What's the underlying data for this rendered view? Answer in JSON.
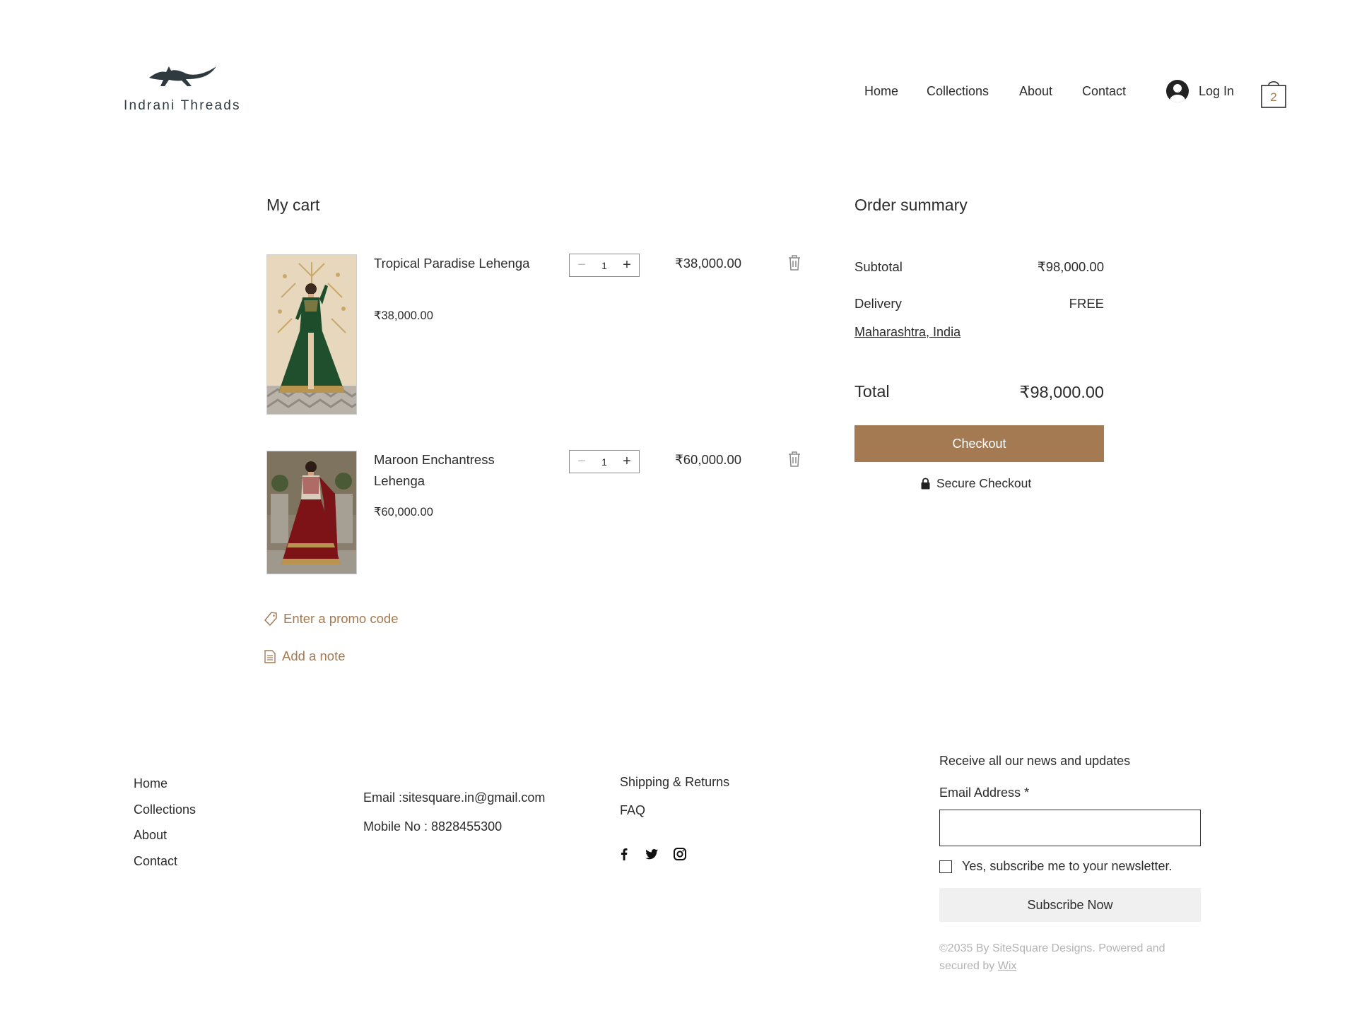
{
  "brand": {
    "name": "Indrani Threads"
  },
  "nav": {
    "items": [
      "Home",
      "Collections",
      "About",
      "Contact"
    ],
    "login_label": "Log In",
    "cart_count": "2"
  },
  "cart": {
    "title": "My cart",
    "items": [
      {
        "name": "Tropical Paradise Lehenga",
        "price": "₹38,000.00",
        "quantity": "1",
        "line_total": "₹38,000.00"
      },
      {
        "name": "Maroon Enchantress Lehenga",
        "price": "₹60,000.00",
        "quantity": "1",
        "line_total": "₹60,000.00"
      }
    ],
    "promo_label": "Enter a promo code",
    "note_label": "Add a note"
  },
  "summary": {
    "title": "Order summary",
    "subtotal_label": "Subtotal",
    "subtotal_value": "₹98,000.00",
    "delivery_label": "Delivery",
    "delivery_value": "FREE",
    "shipping_location": "Maharashtra, India",
    "total_label": "Total",
    "total_value": "₹98,000.00",
    "checkout_label": "Checkout",
    "secure_label": "Secure Checkout"
  },
  "footer": {
    "links": [
      "Home",
      "Collections",
      "About",
      "Contact"
    ],
    "email": "Email :sitesquare.in@gmail.com",
    "mobile": "Mobile No : 8828455300",
    "policy_links": [
      "Shipping & Returns",
      "FAQ"
    ],
    "social": [
      "facebook-icon",
      "twitter-icon",
      "instagram-icon"
    ],
    "newsletter": {
      "heading": "Receive all our news and updates",
      "email_label": "Email Address",
      "required_mark": "*",
      "email_value": "",
      "checkbox_label": "Yes, subscribe me to your newsletter.",
      "button_label": "Subscribe Now"
    },
    "copyright_text": "©2035 By SiteSquare Designs. Powered and secured by",
    "copyright_link": "Wix"
  },
  "colors": {
    "accent": "#a47a52",
    "text": "#2c2c2c",
    "muted": "#b3b3b3",
    "button_gray": "#f0f0f0"
  }
}
